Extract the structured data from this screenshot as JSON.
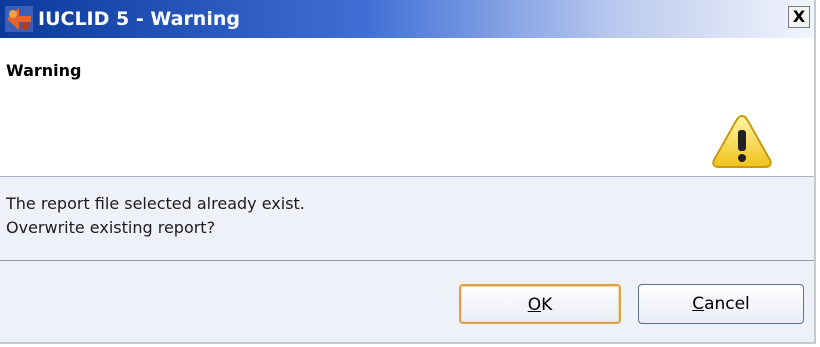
{
  "window": {
    "title": "IUCLID 5 - Warning",
    "close_label": "X",
    "app_icon": "iuclid-logo-icon"
  },
  "header": {
    "title": "Warning",
    "icon": "warning-triangle-icon",
    "icon_color": "#f6d84a"
  },
  "message": {
    "line1": "The report file selected already exist.",
    "line2": "Overwrite existing report?"
  },
  "buttons": {
    "ok": {
      "mnemonic": "O",
      "rest": "K"
    },
    "cancel": {
      "mnemonic": "C",
      "rest": "ancel"
    }
  },
  "colors": {
    "titlebar_start": "#0b3a9c",
    "dialog_background": "#eef1f8",
    "default_button_border": "#d9a24b"
  }
}
